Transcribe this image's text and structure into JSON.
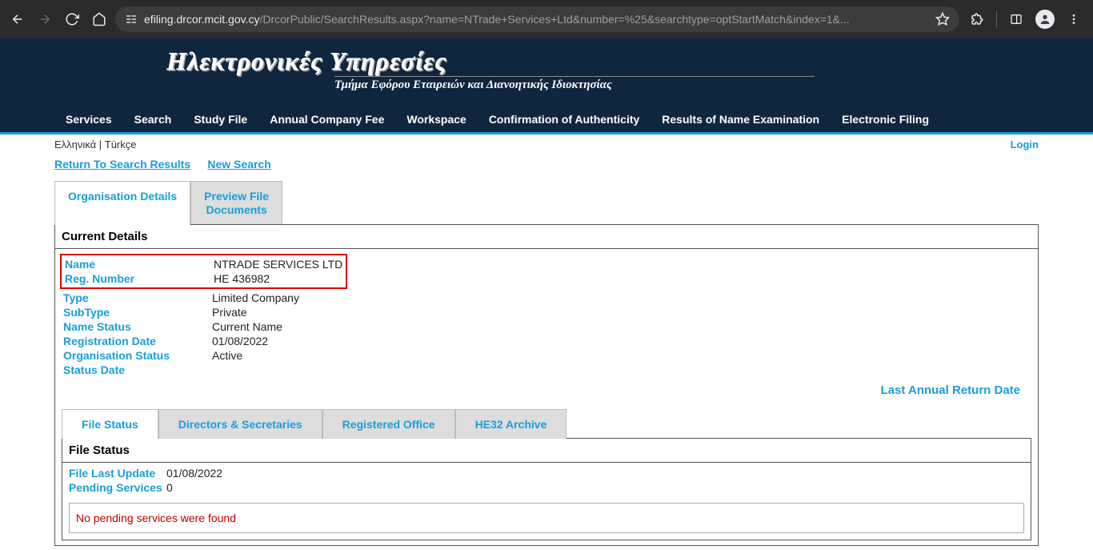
{
  "browser": {
    "url_host": "efiling.drcor.mcit.gov.cy",
    "url_path": "/DrcorPublic/SearchResults.aspx?name=NTrade+Services+Ltd&number=%25&searchtype=optStartMatch&index=1&..."
  },
  "header": {
    "title": "Ηλεκτρονικές Υπηρεσίες",
    "subtitle": "Τμήμα Εφόρου Εταιρειών και Διανοητικής Ιδιοκτησίας"
  },
  "nav": {
    "items": [
      "Services",
      "Search",
      "Study File",
      "Annual Company Fee",
      "Workspace",
      "Confirmation of Authenticity",
      "Results of Name Examination",
      "Electronic Filing"
    ]
  },
  "lang_bar": {
    "greek": "Ελληνικά",
    "sep": " | ",
    "turkish": "Türkçe",
    "login": "Login"
  },
  "search_links": {
    "return": "Return To Search Results",
    "new_search": "New Search"
  },
  "top_tabs": {
    "org": "Organisation Details",
    "preview1": "Preview File",
    "preview2": "Documents"
  },
  "panel": {
    "title": "Current Details",
    "rows": [
      {
        "label": "Name",
        "value": "NTRADE SERVICES LTD"
      },
      {
        "label": "Reg. Number",
        "value": "ΗΕ 436982"
      }
    ],
    "more_rows": [
      {
        "label": "Type",
        "value": "Limited Company"
      },
      {
        "label": "SubType",
        "value": "Private"
      },
      {
        "label": "Name Status",
        "value": "Current Name"
      },
      {
        "label": "Registration Date",
        "value": "01/08/2022"
      },
      {
        "label": "Organisation Status",
        "value": "Active"
      },
      {
        "label": "Status Date",
        "value": ""
      }
    ],
    "last_annual": "Last Annual Return Date"
  },
  "sub_tabs": {
    "items": [
      "File Status",
      "Directors & Secretaries",
      "Registered Office",
      "HE32 Archive"
    ]
  },
  "sub_panel": {
    "title": "File Status",
    "rows": [
      {
        "label": "File Last Update",
        "value": "01/08/2022"
      },
      {
        "label": "Pending Services",
        "value": "0"
      }
    ],
    "no_pending": "No pending services were found"
  }
}
